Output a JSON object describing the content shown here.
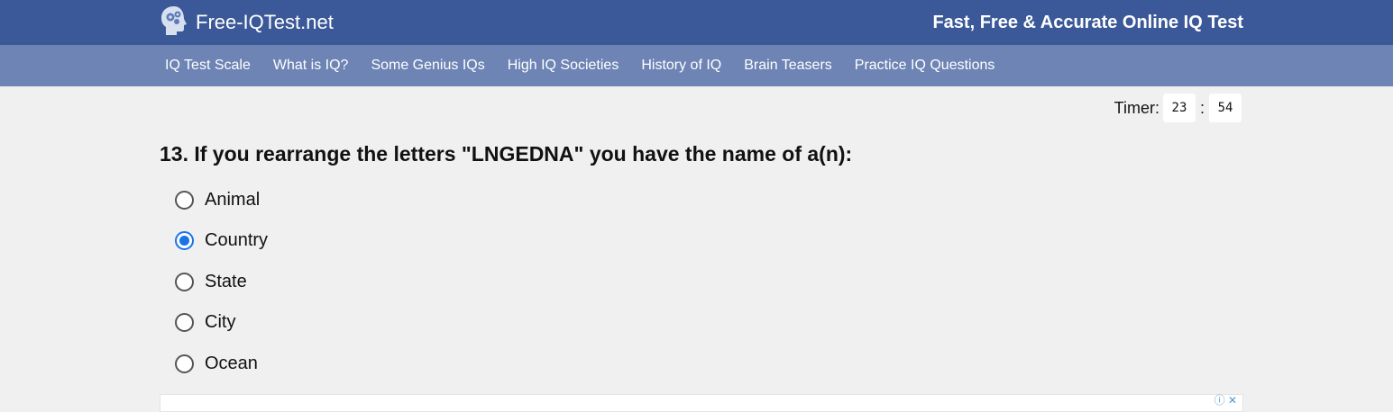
{
  "header": {
    "site_name": "Free-IQTest.net",
    "tagline": "Fast, Free & Accurate Online IQ Test"
  },
  "nav": {
    "items": [
      {
        "label": "IQ Test Scale"
      },
      {
        "label": "What is IQ?"
      },
      {
        "label": "Some Genius IQs"
      },
      {
        "label": "High IQ Societies"
      },
      {
        "label": "History of IQ"
      },
      {
        "label": "Brain Teasers"
      },
      {
        "label": "Practice IQ Questions"
      }
    ]
  },
  "timer": {
    "label": "Timer:",
    "minutes": "23",
    "separator": ":",
    "seconds": "54"
  },
  "question": {
    "text": "13. If you rearrange the letters \"LNGEDNA\" you have the name of a(n):",
    "options": [
      {
        "label": "Animal",
        "selected": false
      },
      {
        "label": "Country",
        "selected": true
      },
      {
        "label": "State",
        "selected": false
      },
      {
        "label": "City",
        "selected": false
      },
      {
        "label": "Ocean",
        "selected": false
      }
    ]
  },
  "colors": {
    "header_bg": "#3b5998",
    "nav_bg": "#6d84b4",
    "page_bg": "#f0f0f0",
    "radio_selected": "#1a73e8"
  },
  "icons": {
    "logo": "head-gears-icon",
    "ad_info": "info-icon",
    "ad_close": "close-icon"
  }
}
